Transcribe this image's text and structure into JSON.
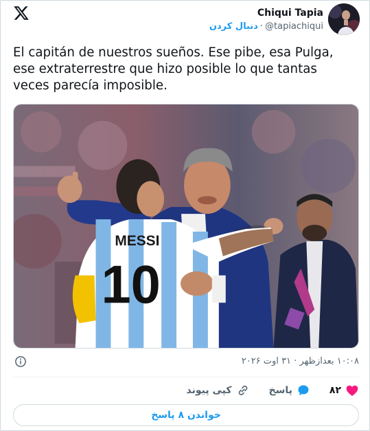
{
  "author": {
    "name": "Chiqui Tapia",
    "follow_label": "دنبال کردن",
    "separator": "·",
    "handle": "@tapiachiqui"
  },
  "tweet": {
    "text": "El capitán de nuestros sueños. Ese pibe, esa Pulga, ese extraterrestre que hizo posible lo que tantas veces parecía imposible."
  },
  "photo": {
    "jersey_name": "MESSI",
    "jersey_number": "10"
  },
  "meta": {
    "timestamp": "۱۰:۰۸ بعدازظهر · ۳۱ اوت ۲۰۲۶"
  },
  "actions": {
    "like_count": "۸۲",
    "reply_label": "پاسخ",
    "copy_link_label": "کپی پیوند"
  },
  "read_replies_label": "خواندن ۸ پاسخ",
  "colors": {
    "accent": "#1d9bf0",
    "like": "#f91880",
    "text": "#0f1419",
    "muted": "#536471"
  }
}
